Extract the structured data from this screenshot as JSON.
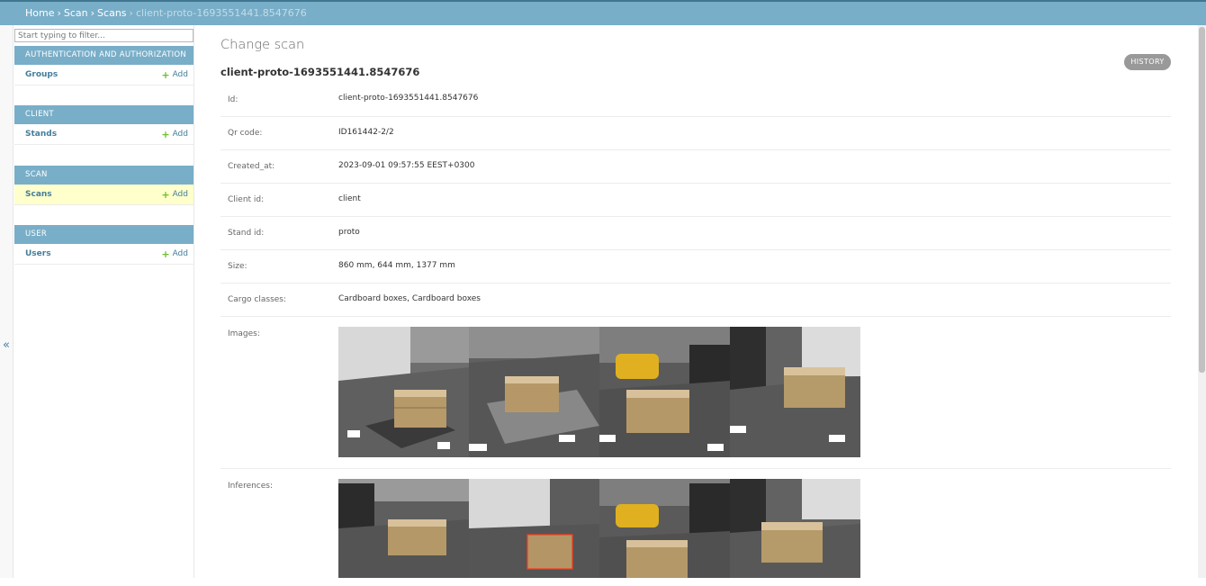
{
  "breadcrumbs": {
    "home": "Home",
    "scan": "Scan",
    "scans": "Scans",
    "current": "client-proto-1693551441.8547676"
  },
  "sidebar": {
    "filter_placeholder": "Start typing to filter...",
    "collapse_glyph": "«",
    "modules": [
      {
        "title": "Authentication and Authorization",
        "items": [
          {
            "label": "Groups",
            "add": "Add"
          }
        ]
      },
      {
        "title": "Client",
        "items": [
          {
            "label": "Stands",
            "add": "Add"
          }
        ]
      },
      {
        "title": "Scan",
        "items": [
          {
            "label": "Scans",
            "add": "Add"
          }
        ]
      },
      {
        "title": "User",
        "items": [
          {
            "label": "Users",
            "add": "Add"
          }
        ]
      }
    ]
  },
  "main": {
    "page_title": "Change scan",
    "object_title": "client-proto-1693551441.8547676",
    "history_label": "History",
    "fields": [
      {
        "label": "Id:",
        "value": "client-proto-1693551441.8547676"
      },
      {
        "label": "Qr code:",
        "value": "ID161442-2/2"
      },
      {
        "label": "Created_at:",
        "value": "2023-09-01 09:57:55 EEST+0300"
      },
      {
        "label": "Client id:",
        "value": "client"
      },
      {
        "label": "Stand id:",
        "value": "proto"
      },
      {
        "label": "Size:",
        "value": "860 mm, 644 mm, 1377 mm"
      },
      {
        "label": "Cargo classes:",
        "value": "Cardboard boxes, Cardboard boxes"
      }
    ],
    "images_label": "Images:",
    "inferences_label": "Inferences:"
  },
  "colors": {
    "header": "#79aec8",
    "link": "#447e9b",
    "add_plus": "#70bf2b",
    "active_row": "#ffffcc"
  }
}
